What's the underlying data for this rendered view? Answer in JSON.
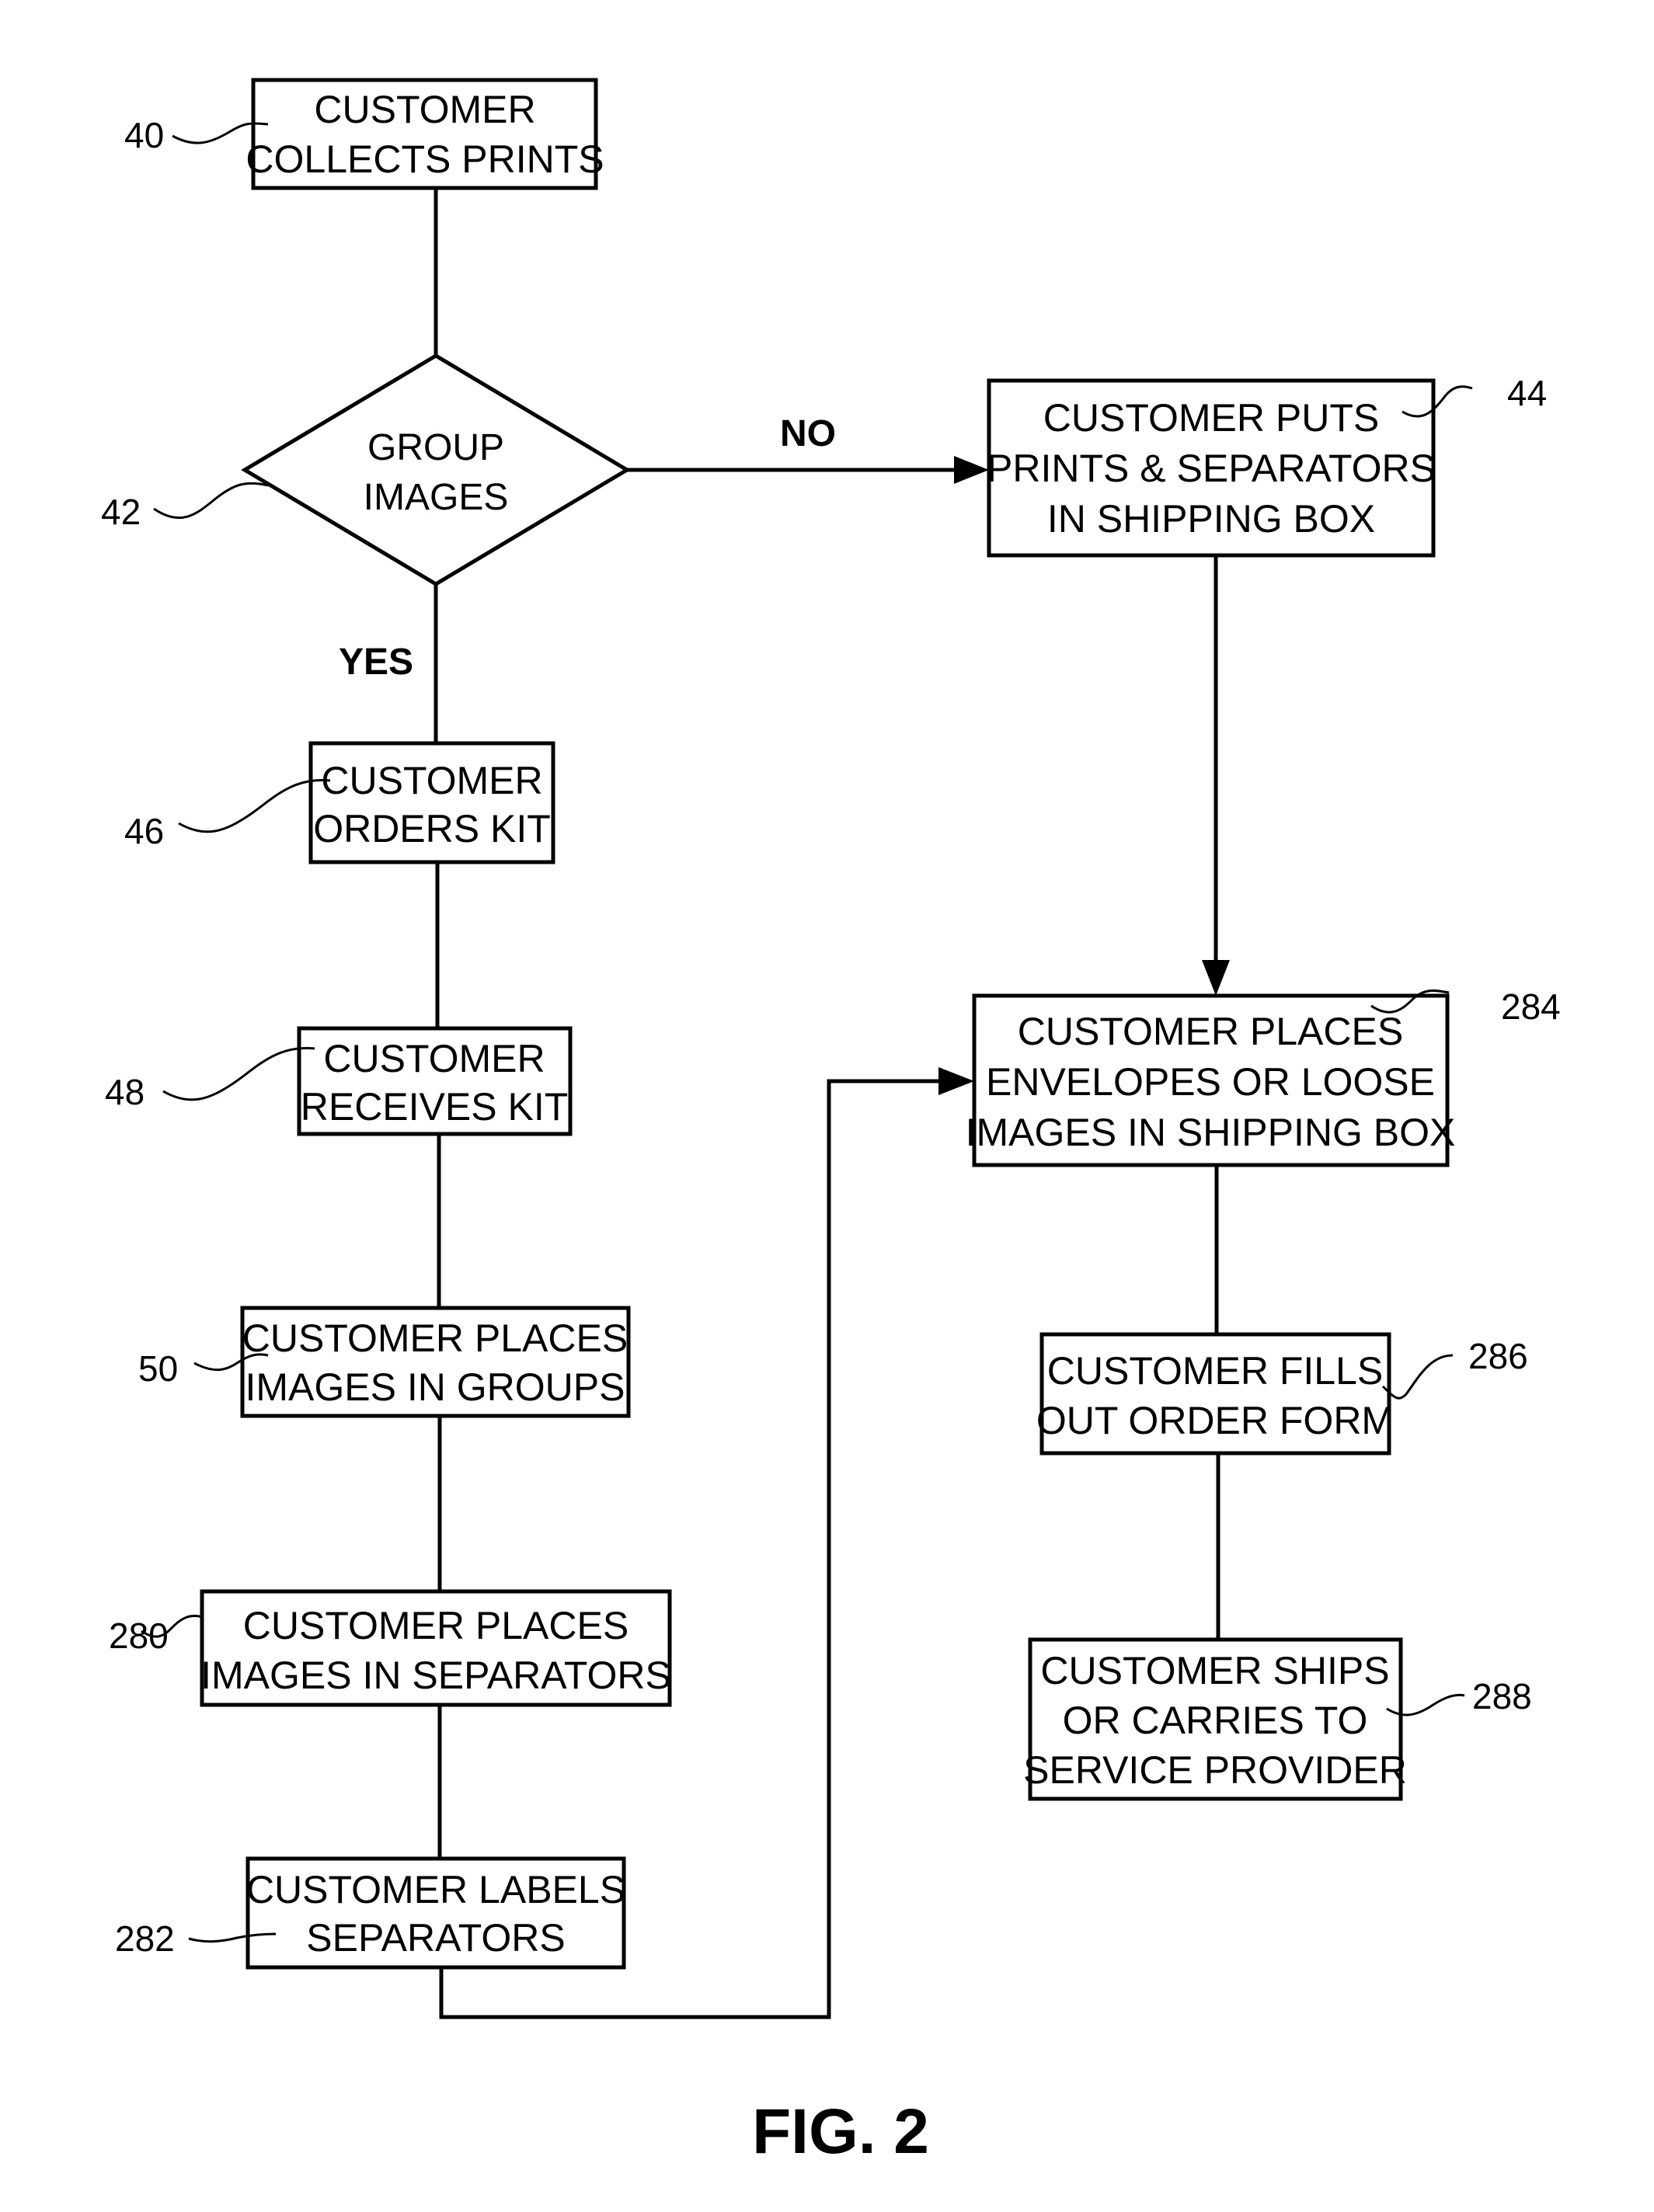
{
  "figure": {
    "caption": "FIG. 2"
  },
  "nodes": {
    "n40": {
      "ref": "40",
      "type": "process",
      "lines": [
        "CUSTOMER",
        "COLLECTS PRINTS"
      ]
    },
    "n42": {
      "ref": "42",
      "type": "decision",
      "lines": [
        "GROUP",
        "IMAGES"
      ]
    },
    "n44": {
      "ref": "44",
      "type": "process",
      "lines": [
        "CUSTOMER PUTS",
        "PRINTS & SEPARATORS",
        "IN SHIPPING BOX"
      ]
    },
    "n46": {
      "ref": "46",
      "type": "process",
      "lines": [
        "CUSTOMER",
        "ORDERS KIT"
      ]
    },
    "n48": {
      "ref": "48",
      "type": "process",
      "lines": [
        "CUSTOMER",
        "RECEIVES KIT"
      ]
    },
    "n50": {
      "ref": "50",
      "type": "process",
      "lines": [
        "CUSTOMER PLACES",
        "IMAGES IN GROUPS"
      ]
    },
    "n280": {
      "ref": "280",
      "type": "process",
      "lines": [
        "CUSTOMER PLACES",
        "IMAGES IN SEPARATORS"
      ]
    },
    "n282": {
      "ref": "282",
      "type": "process",
      "lines": [
        "CUSTOMER LABELS",
        "SEPARATORS"
      ]
    },
    "n284": {
      "ref": "284",
      "type": "process",
      "lines": [
        "CUSTOMER PLACES",
        "ENVELOPES OR LOOSE",
        "IMAGES IN SHIPPING BOX"
      ]
    },
    "n286": {
      "ref": "286",
      "type": "process",
      "lines": [
        "CUSTOMER FILLS",
        "OUT ORDER FORM"
      ]
    },
    "n288": {
      "ref": "288",
      "type": "process",
      "lines": [
        "CUSTOMER SHIPS",
        "OR CARRIES TO",
        "SERVICE PROVIDER"
      ]
    }
  },
  "edges": [
    {
      "from": "40",
      "to": "42",
      "label": "",
      "arrow": false
    },
    {
      "from": "42",
      "to": "44",
      "label": "NO",
      "arrow": true
    },
    {
      "from": "42",
      "to": "46",
      "label": "YES",
      "arrow": false
    },
    {
      "from": "46",
      "to": "48",
      "label": "",
      "arrow": false
    },
    {
      "from": "48",
      "to": "50",
      "label": "",
      "arrow": false
    },
    {
      "from": "50",
      "to": "280",
      "label": "",
      "arrow": false
    },
    {
      "from": "280",
      "to": "282",
      "label": "",
      "arrow": false
    },
    {
      "from": "282",
      "to": "284",
      "label": "",
      "arrow": true
    },
    {
      "from": "44",
      "to": "284",
      "label": "",
      "arrow": true
    },
    {
      "from": "284",
      "to": "286",
      "label": "",
      "arrow": false
    },
    {
      "from": "286",
      "to": "288",
      "label": "",
      "arrow": false
    }
  ],
  "branch_labels": {
    "no": "NO",
    "yes": "YES"
  }
}
